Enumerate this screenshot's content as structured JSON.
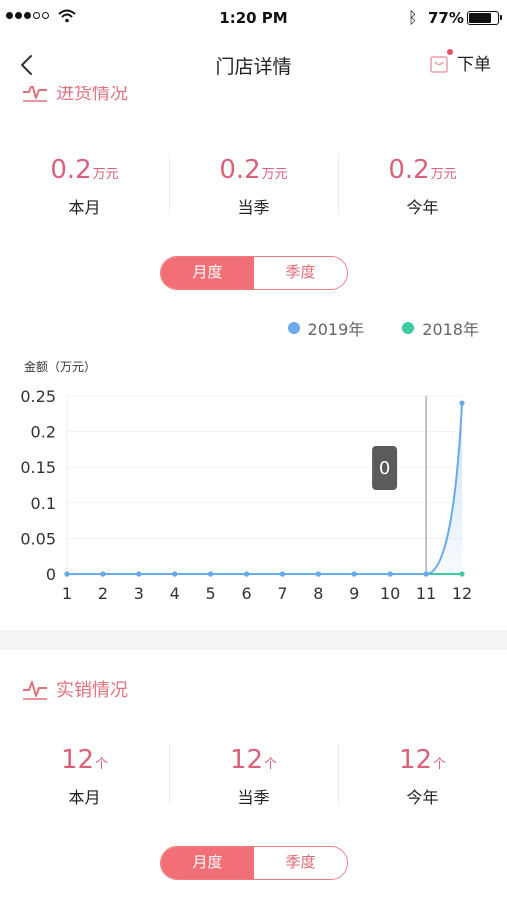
{
  "status_bar": {
    "time": "1:20 PM",
    "battery": "77%"
  },
  "nav": {
    "title": "门店详情",
    "order_label": "下单"
  },
  "purchase": {
    "title": "进货情况",
    "stats": [
      {
        "value": "0.2",
        "unit": "万元",
        "label": "本月"
      },
      {
        "value": "0.2",
        "unit": "万元",
        "label": "当季"
      },
      {
        "value": "0.2",
        "unit": "万元",
        "label": "今年"
      }
    ],
    "toggle": {
      "active": "月度",
      "inactive": "季度"
    }
  },
  "sales": {
    "title": "实销情况",
    "stats": [
      {
        "value": "12",
        "unit": "个",
        "label": "本月"
      },
      {
        "value": "12",
        "unit": "个",
        "label": "当季"
      },
      {
        "value": "12",
        "unit": "个",
        "label": "今年"
      }
    ],
    "toggle": {
      "active": "月度",
      "inactive": "季度"
    }
  },
  "chart_data": {
    "type": "line",
    "ylabel": "金额（万元）",
    "categories": [
      "1",
      "2",
      "3",
      "4",
      "5",
      "6",
      "7",
      "8",
      "9",
      "10",
      "11",
      "12"
    ],
    "yticks": [
      "0",
      "0.05",
      "0.1",
      "0.15",
      "0.2",
      "0.25"
    ],
    "ylim": [
      0,
      0.25
    ],
    "grid": true,
    "legend_position": "top-right",
    "series": [
      {
        "name": "2019年",
        "color": "#6aa9ea",
        "values": [
          0,
          0,
          0,
          0,
          0,
          0,
          0,
          0,
          0,
          0,
          0,
          0.24
        ]
      },
      {
        "name": "2018年",
        "color": "#3ecba0",
        "values": [
          0,
          0,
          0,
          0,
          0,
          0,
          0,
          0,
          0,
          0,
          0,
          0
        ]
      }
    ],
    "tooltip": {
      "text": "0",
      "category": "11"
    }
  }
}
